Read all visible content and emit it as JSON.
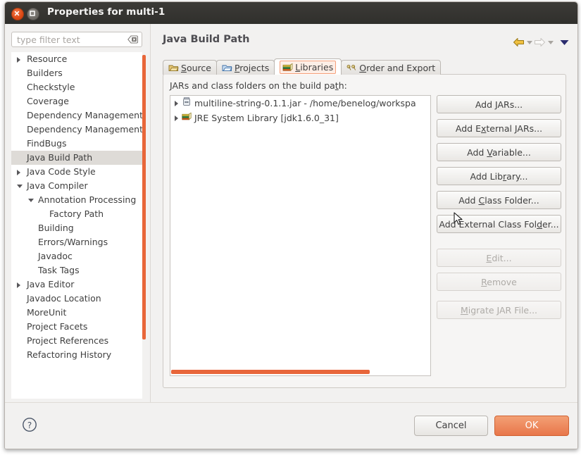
{
  "window": {
    "title": "Properties for multi-1",
    "close_icon": "close-icon",
    "maximize_icon": "maximize-icon"
  },
  "sidebar": {
    "filter": {
      "value": "",
      "placeholder": "type filter text",
      "clear_icon": "clear-icon"
    },
    "items": [
      {
        "label": "Resource",
        "indent": 0,
        "twisty": "collapsed",
        "selected": false
      },
      {
        "label": "Builders",
        "indent": 0,
        "twisty": "none",
        "selected": false
      },
      {
        "label": "Checkstyle",
        "indent": 0,
        "twisty": "none",
        "selected": false
      },
      {
        "label": "Coverage",
        "indent": 0,
        "twisty": "none",
        "selected": false
      },
      {
        "label": "Dependency Management",
        "indent": 0,
        "twisty": "none",
        "selected": false
      },
      {
        "label": "Dependency Management",
        "indent": 0,
        "twisty": "none",
        "selected": false
      },
      {
        "label": "FindBugs",
        "indent": 0,
        "twisty": "none",
        "selected": false
      },
      {
        "label": "Java Build Path",
        "indent": 0,
        "twisty": "none",
        "selected": true
      },
      {
        "label": "Java Code Style",
        "indent": 0,
        "twisty": "collapsed",
        "selected": false
      },
      {
        "label": "Java Compiler",
        "indent": 0,
        "twisty": "expanded",
        "selected": false
      },
      {
        "label": "Annotation Processing",
        "indent": 1,
        "twisty": "expanded",
        "selected": false
      },
      {
        "label": "Factory Path",
        "indent": 2,
        "twisty": "none",
        "selected": false
      },
      {
        "label": "Building",
        "indent": 1,
        "twisty": "none",
        "selected": false
      },
      {
        "label": "Errors/Warnings",
        "indent": 1,
        "twisty": "none",
        "selected": false
      },
      {
        "label": "Javadoc",
        "indent": 1,
        "twisty": "none",
        "selected": false
      },
      {
        "label": "Task Tags",
        "indent": 1,
        "twisty": "none",
        "selected": false
      },
      {
        "label": "Java Editor",
        "indent": 0,
        "twisty": "collapsed",
        "selected": false
      },
      {
        "label": "Javadoc Location",
        "indent": 0,
        "twisty": "none",
        "selected": false
      },
      {
        "label": "MoreUnit",
        "indent": 0,
        "twisty": "none",
        "selected": false
      },
      {
        "label": "Project Facets",
        "indent": 0,
        "twisty": "none",
        "selected": false
      },
      {
        "label": "Project References",
        "indent": 0,
        "twisty": "none",
        "selected": false
      },
      {
        "label": "Refactoring History",
        "indent": 0,
        "twisty": "none",
        "selected": false
      }
    ]
  },
  "page": {
    "title": "Java Build Path",
    "nav": {
      "back_icon": "back-arrow-icon",
      "forward_icon": "forward-arrow-icon",
      "menu_icon": "chevron-down-icon"
    }
  },
  "tabs": [
    {
      "label": "Source",
      "mnemonic": "S",
      "icon": "source-folder-icon",
      "active": false
    },
    {
      "label": "Projects",
      "mnemonic": "P",
      "icon": "projects-folder-icon",
      "active": false
    },
    {
      "label": "Libraries",
      "mnemonic": "L",
      "icon": "libraries-books-icon",
      "active": true
    },
    {
      "label": "Order and Export",
      "mnemonic": "O",
      "icon": "order-export-icon",
      "active": false
    }
  ],
  "group": {
    "label_pre": "JARs and class folders on the build pa",
    "label_mnemonic": "t",
    "label_post": "h:",
    "entries": [
      {
        "label": "multiline-string-0.1.1.jar - /home/benelog/workspa",
        "icon": "jar-icon",
        "twisty": "collapsed"
      },
      {
        "label": "JRE System Library [jdk1.6.0_31]",
        "icon": "library-icon",
        "twisty": "collapsed"
      }
    ],
    "hscroll": {
      "name": "horizontal-scrollbar"
    }
  },
  "buttons": [
    {
      "pre": "Add ",
      "mn": "J",
      "post": "ARs...",
      "enabled": true,
      "name": "add-jars-button"
    },
    {
      "pre": "Add E",
      "mn": "x",
      "post": "ternal JARs...",
      "enabled": true,
      "name": "add-external-jars-button"
    },
    {
      "pre": "Add ",
      "mn": "V",
      "post": "ariable...",
      "enabled": true,
      "name": "add-variable-button"
    },
    {
      "pre": "Add Lib",
      "mn": "r",
      "post": "ary...",
      "enabled": true,
      "name": "add-library-button"
    },
    {
      "pre": "Add ",
      "mn": "C",
      "post": "lass Folder...",
      "enabled": true,
      "name": "add-class-folder-button"
    },
    {
      "pre": "Add External Class Fol",
      "mn": "d",
      "post": "er...",
      "enabled": true,
      "name": "add-external-class-folder-button"
    },
    {
      "pre": "",
      "mn": "E",
      "post": "dit...",
      "enabled": false,
      "name": "edit-button"
    },
    {
      "pre": "",
      "mn": "R",
      "post": "emove",
      "enabled": false,
      "name": "remove-button"
    },
    {
      "pre": "",
      "mn": "M",
      "post": "igrate JAR File...",
      "enabled": false,
      "name": "migrate-jar-file-button"
    }
  ],
  "footer": {
    "help_icon": "help-icon",
    "cancel_label": "Cancel",
    "ok_label": "OK"
  },
  "colors": {
    "accent_orange": "#e8663a",
    "ok_button": "#e8764a",
    "titlebar": "#333229",
    "selection": "#dedbd7"
  }
}
